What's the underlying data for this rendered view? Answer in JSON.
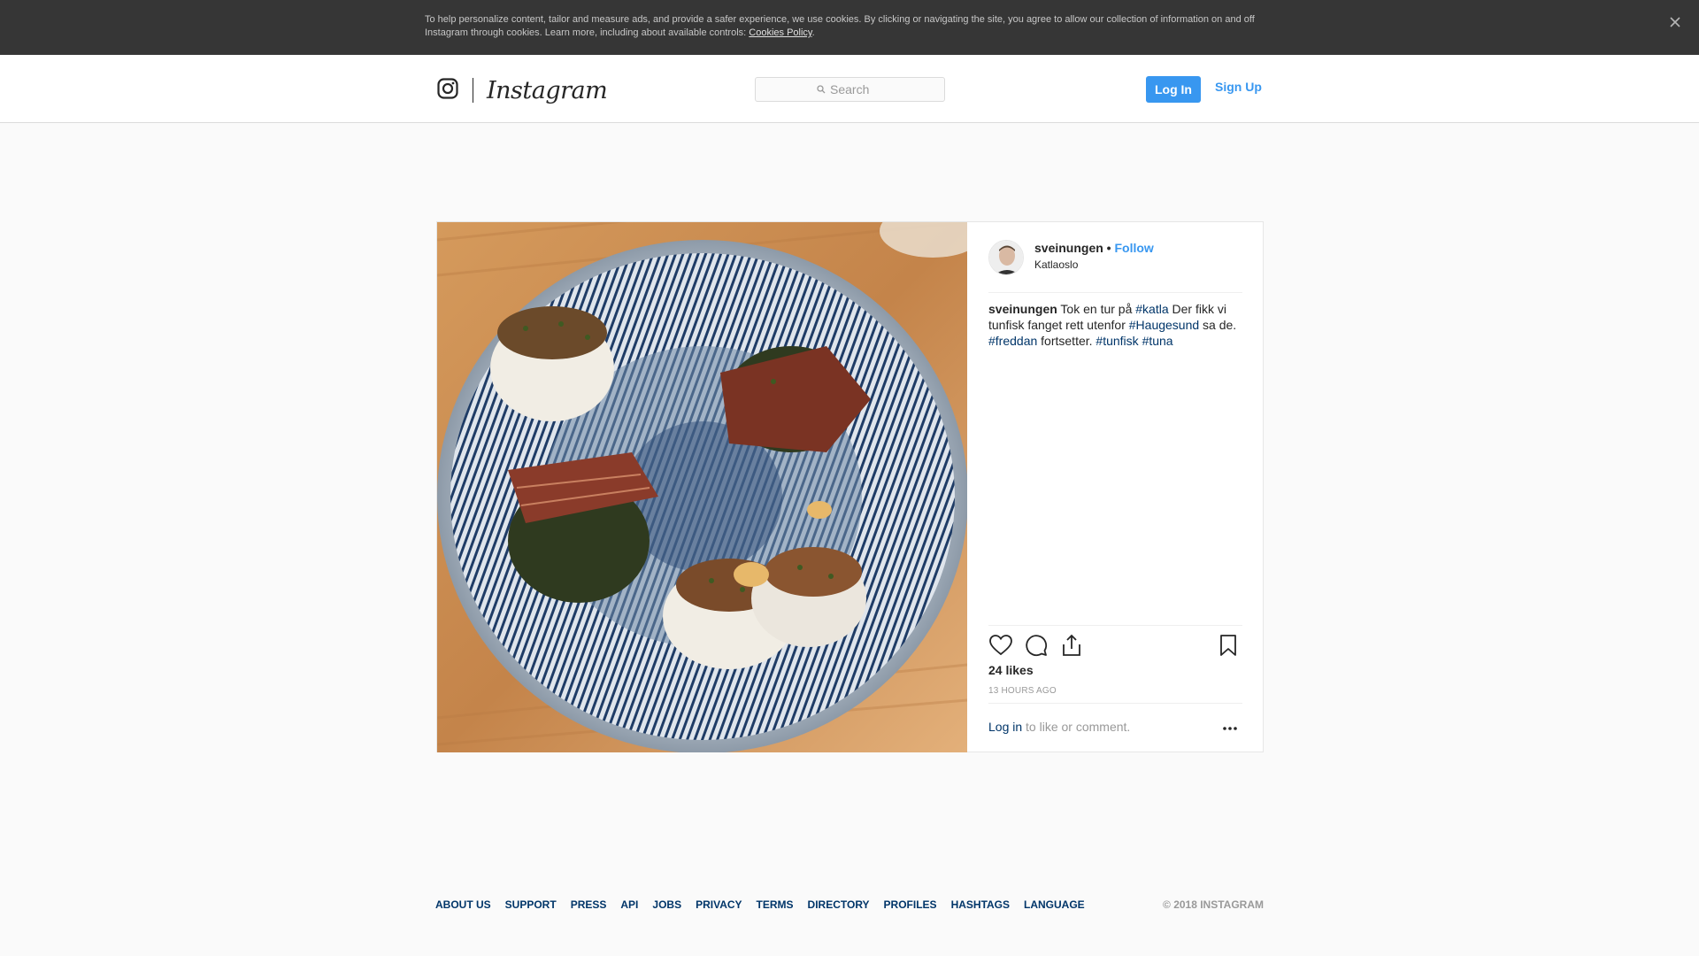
{
  "cookie_bar": {
    "text": "To help personalize content, tailor and measure ads, and provide a safer experience, we use cookies. By clicking or navigating the site, you agree to allow our collection of information on and off Instagram through cookies. Learn more, including about available controls: ",
    "link": "Cookies Policy",
    "after": ".",
    "close_icon": "close-icon"
  },
  "nav": {
    "logo_icon": "instagram-camera-icon",
    "wordmark": "Instagram",
    "search_placeholder": "Search",
    "search_icon": "search-icon",
    "login_label": "Log In",
    "signup_label": "Sign Up",
    "accent_color": "#3897f0"
  },
  "post": {
    "username": "sveinungen",
    "separator": " • ",
    "follow_label": "Follow",
    "location": "Katlaoslo",
    "caption": {
      "username": "sveinungen",
      "segments": [
        {
          "t": " Tok en tur på "
        },
        {
          "tag": "#katla"
        },
        {
          "t": " Der fikk vi tunfisk fanget rett utenfor "
        },
        {
          "tag": "#Haugesund"
        },
        {
          "t": " sa de. "
        },
        {
          "tag": "#freddan"
        },
        {
          "t": " fortsetter. "
        },
        {
          "tag": "#tunfisk"
        },
        {
          "t": " "
        },
        {
          "tag": "#tuna"
        }
      ]
    },
    "icons": [
      "heart-icon",
      "comment-icon",
      "share-icon",
      "bookmark-icon"
    ],
    "likes": "24 likes",
    "time": "13 hours ago",
    "comment_prompt": {
      "link": "Log in",
      "rest": " to like or comment."
    },
    "more_icon": "more-options-icon"
  },
  "footer": {
    "links": [
      "About us",
      "Support",
      "Press",
      "API",
      "Jobs",
      "Privacy",
      "Terms",
      "Directory",
      "Profiles",
      "Hashtags",
      "Language"
    ],
    "copyright": "© 2018 Instagram"
  }
}
